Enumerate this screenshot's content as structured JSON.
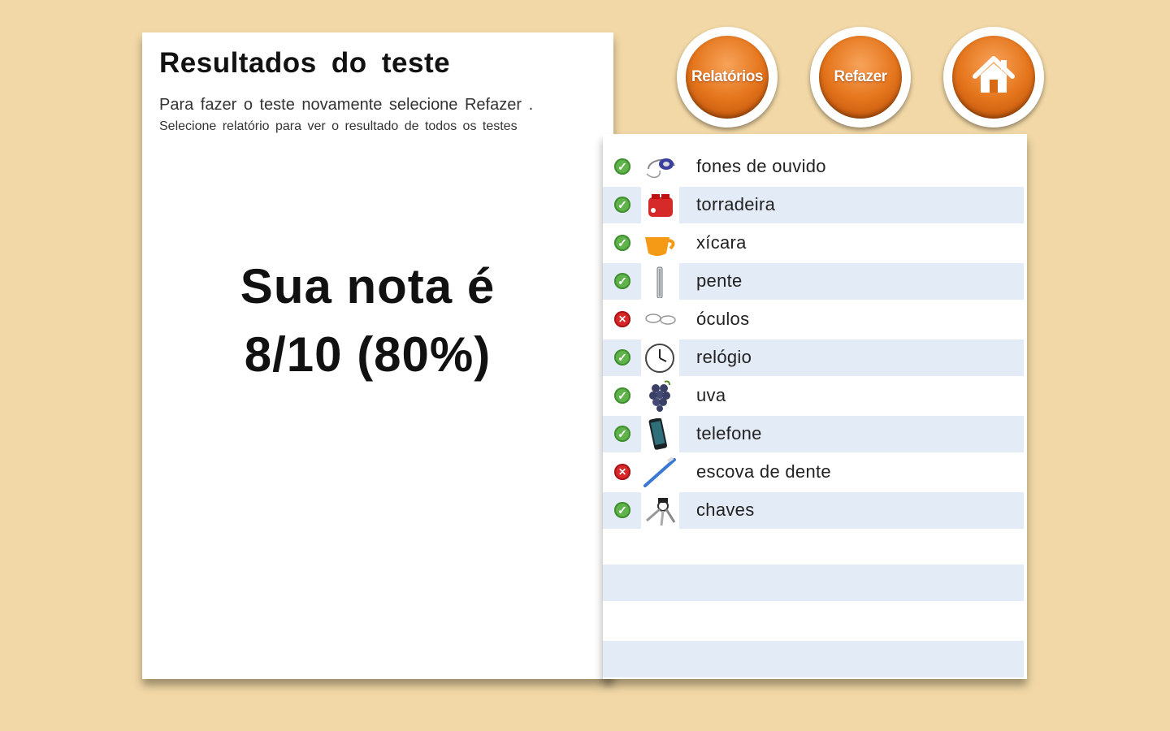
{
  "results": {
    "title": "Resultados do teste",
    "instruction_1": "Para fazer o teste novamente selecione  Refazer .",
    "instruction_2": "Selecione  relatório para ver o resultado de todos os testes",
    "score_line_1": "Sua nota é",
    "score_line_2": "8/10 (80%)"
  },
  "nav": {
    "reports_label": "Relatórios",
    "redo_label": "Refazer",
    "home_icon": "home-icon"
  },
  "items": [
    {
      "label": "fones de ouvido",
      "status": "correct",
      "icon": "headphones-icon"
    },
    {
      "label": "torradeira",
      "status": "correct",
      "icon": "toaster-icon"
    },
    {
      "label": "xícara",
      "status": "correct",
      "icon": "cup-icon"
    },
    {
      "label": "pente",
      "status": "correct",
      "icon": "comb-icon"
    },
    {
      "label": "óculos",
      "status": "wrong",
      "icon": "glasses-icon"
    },
    {
      "label": "relógio",
      "status": "correct",
      "icon": "clock-icon"
    },
    {
      "label": "uva",
      "status": "correct",
      "icon": "grapes-icon"
    },
    {
      "label": "telefone",
      "status": "correct",
      "icon": "phone-icon"
    },
    {
      "label": "escova de dente",
      "status": "wrong",
      "icon": "toothbrush-icon"
    },
    {
      "label": "chaves",
      "status": "correct",
      "icon": "keys-icon"
    }
  ],
  "colors": {
    "background": "#f2d8a6",
    "row_alt": "#e3ebf6",
    "correct": "#5fb34a",
    "wrong": "#d8282a",
    "button": "#e5761d"
  }
}
